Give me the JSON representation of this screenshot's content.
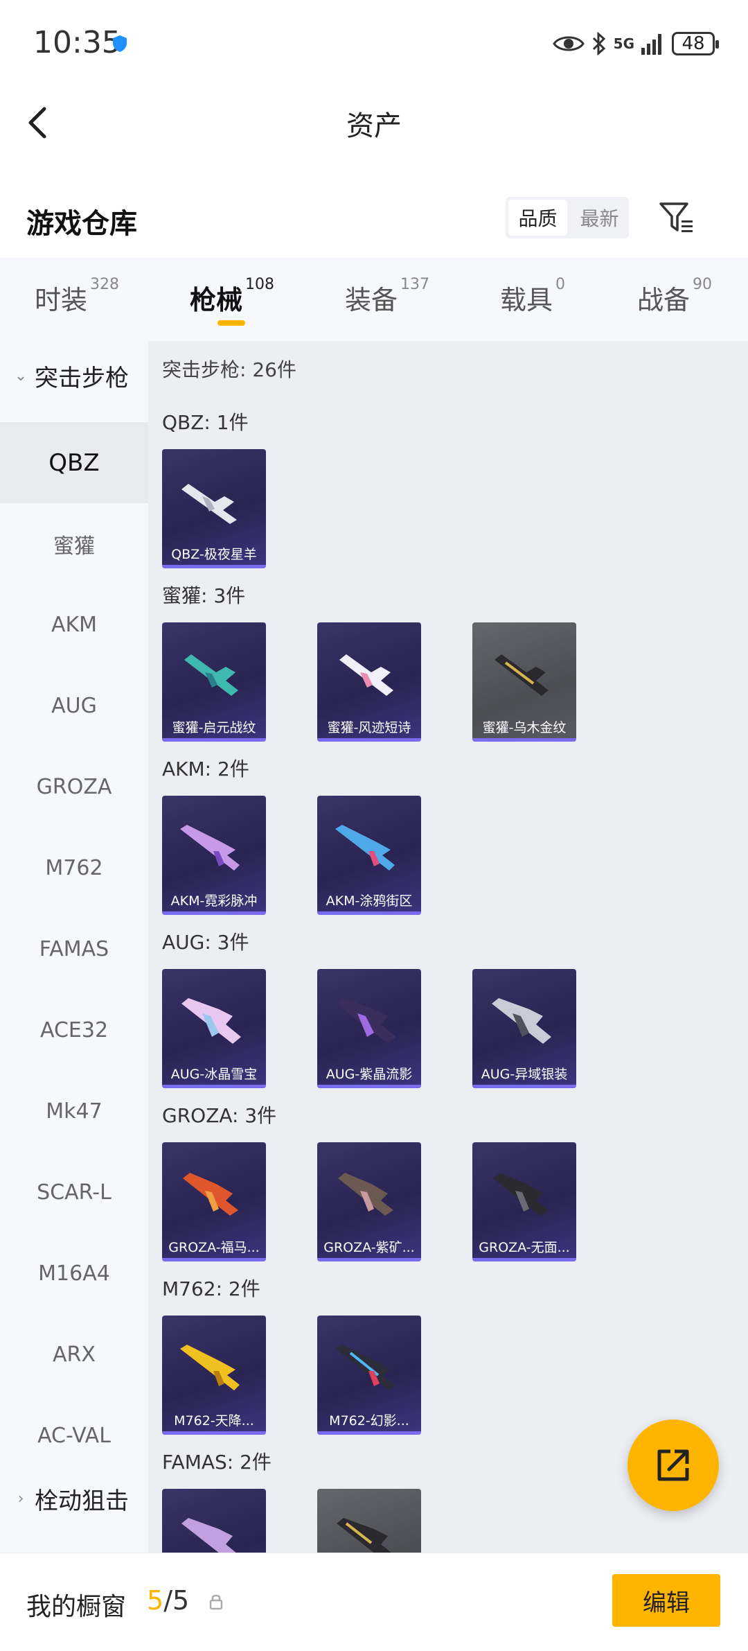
{
  "status": {
    "time": "10:35",
    "battery": "48",
    "network": "5G"
  },
  "header": {
    "title": "资产"
  },
  "warehouse": {
    "title": "游戏仓库",
    "sort_options": [
      "品质",
      "最新"
    ]
  },
  "tabs": [
    {
      "label": "时装",
      "count": "328"
    },
    {
      "label": "枪械",
      "count": "108"
    },
    {
      "label": "装备",
      "count": "137"
    },
    {
      "label": "载具",
      "count": "0"
    },
    {
      "label": "战备",
      "count": "90"
    }
  ],
  "sidebar": {
    "group_open": "突击步枪",
    "items": [
      "QBZ",
      "蜜獾",
      "AKM",
      "AUG",
      "GROZA",
      "M762",
      "FAMAS",
      "ACE32",
      "Mk47",
      "SCAR-L",
      "M16A4",
      "ARX",
      "AC-VAL"
    ],
    "group_closed": "栓动狙击"
  },
  "content": {
    "group_heading": "突击步枪: 26件",
    "sections": [
      {
        "heading": "QBZ: 1件",
        "items": [
          {
            "label": "QBZ-极夜星羊"
          }
        ]
      },
      {
        "heading": "蜜獾: 3件",
        "items": [
          {
            "label": "蜜獾-启元战纹"
          },
          {
            "label": "蜜獾-风迹短诗"
          },
          {
            "label": "蜜獾-乌木金纹"
          }
        ]
      },
      {
        "heading": "AKM: 2件",
        "items": [
          {
            "label": "AKM-霓彩脉冲"
          },
          {
            "label": "AKM-涂鸦街区"
          }
        ]
      },
      {
        "heading": "AUG: 3件",
        "items": [
          {
            "label": "AUG-冰晶雪宝"
          },
          {
            "label": "AUG-紫晶流影"
          },
          {
            "label": "AUG-异域银装"
          }
        ]
      },
      {
        "heading": "GROZA: 3件",
        "items": [
          {
            "label": "GROZA-福马..."
          },
          {
            "label": "GROZA-紫矿..."
          },
          {
            "label": "GROZA-无面..."
          }
        ]
      },
      {
        "heading": "M762: 2件",
        "items": [
          {
            "label": "M762-天降..."
          },
          {
            "label": "M762-幻影..."
          }
        ]
      },
      {
        "heading": "FAMAS: 2件",
        "items": [
          {
            "label": ""
          },
          {
            "label": ""
          }
        ]
      }
    ]
  },
  "showcase": {
    "label": "我的橱窗",
    "current": "5",
    "total": "/5",
    "edit_label": "编辑"
  }
}
